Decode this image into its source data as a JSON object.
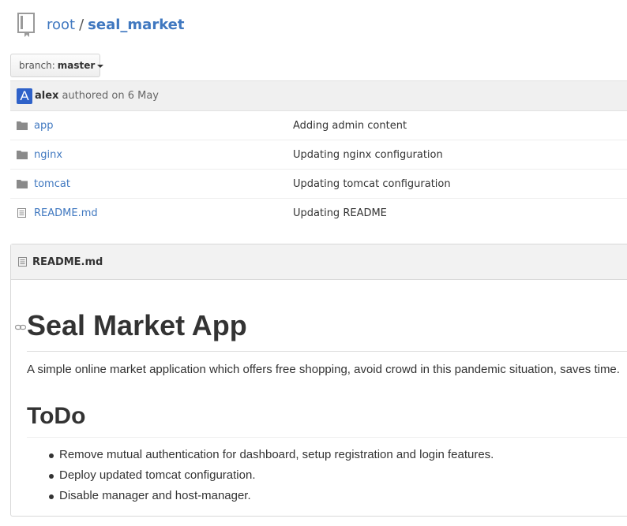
{
  "repo": {
    "owner": "root",
    "separator": "/",
    "name": "seal_market"
  },
  "branch": {
    "prefix": "branch:",
    "name": "master"
  },
  "commit": {
    "avatar_letter": "A",
    "author": "alex",
    "authored_text": "authored on 6 May",
    "avatar_color": "#2f62c9"
  },
  "files": [
    {
      "type": "folder",
      "icon": "folder-icon",
      "name": "app",
      "message": "Adding admin content"
    },
    {
      "type": "folder",
      "icon": "folder-icon",
      "name": "nginx",
      "message": "Updating nginx configuration"
    },
    {
      "type": "folder",
      "icon": "folder-icon",
      "name": "tomcat",
      "message": "Updating tomcat configuration"
    },
    {
      "type": "file",
      "icon": "file-icon",
      "name": "README.md",
      "message": "Updating README"
    }
  ],
  "readme": {
    "filename": "README.md",
    "title": "Seal Market App",
    "description": "A simple online market application which offers free shopping, avoid crowd in this pandemic situation, saves time.",
    "section_title": "ToDo",
    "todo": [
      "Remove mutual authentication for dashboard, setup registration and login features.",
      "Deploy updated tomcat configuration.",
      "Disable manager and host-manager."
    ]
  },
  "colors": {
    "link": "#4078c0",
    "text": "#333333",
    "icon_gray": "#8a8a8a"
  }
}
